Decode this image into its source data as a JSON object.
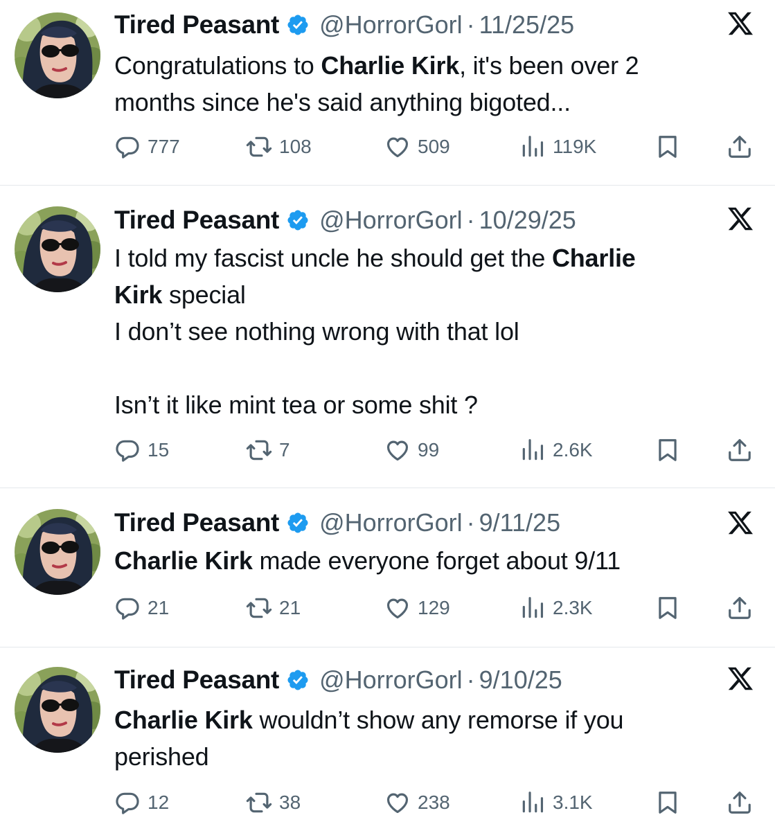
{
  "tweets": [
    {
      "name": "Tired Peasant",
      "handle": "@HorrorGorl",
      "separator": "·",
      "date": "11/25/25",
      "lines": [
        [
          {
            "t": "Congratulations to "
          },
          {
            "t": "Charlie Kirk",
            "b": true
          },
          {
            "t": ", it's been over 2"
          }
        ],
        [
          {
            "t": "months since he's said anything bigoted..."
          }
        ]
      ],
      "stats": {
        "replies": "777",
        "reposts": "108",
        "likes": "509",
        "views": "119K"
      }
    },
    {
      "name": "Tired Peasant",
      "handle": "@HorrorGorl",
      "separator": "·",
      "date": "10/29/25",
      "lines": [
        [
          {
            "t": "I told my fascist uncle he should get the "
          },
          {
            "t": "Charlie",
            "b": true
          }
        ],
        [
          {
            "t": "Kirk",
            "b": true
          },
          {
            "t": " special"
          }
        ],
        [
          {
            "t": "I don’t see nothing wrong with that  lol"
          }
        ],
        [],
        [
          {
            "t": "Isn’t it like mint tea or some shit ?"
          }
        ]
      ],
      "stats": {
        "replies": "15",
        "reposts": "7",
        "likes": "99",
        "views": "2.6K"
      }
    },
    {
      "name": "Tired Peasant",
      "handle": "@HorrorGorl",
      "separator": "·",
      "date": "9/11/25",
      "lines": [
        [
          {
            "t": "Charlie Kirk",
            "b": true
          },
          {
            "t": " made everyone forget about 9/11"
          }
        ]
      ],
      "stats": {
        "replies": "21",
        "reposts": "21",
        "likes": "129",
        "views": "2.3K"
      }
    },
    {
      "name": "Tired Peasant",
      "handle": "@HorrorGorl",
      "separator": "·",
      "date": "9/10/25",
      "lines": [
        [
          {
            "t": "Charlie Kirk",
            "b": true
          },
          {
            "t": " wouldn’t show any remorse if you"
          }
        ],
        [
          {
            "t": "perished"
          }
        ]
      ],
      "stats": {
        "replies": "12",
        "reposts": "38",
        "likes": "238",
        "views": "3.1K"
      }
    }
  ],
  "colors": {
    "text": "#0f1419",
    "muted": "#536471",
    "verified": "#1d9bf0",
    "divider": "#e4e8eb"
  },
  "icons": [
    "avatar",
    "verified-badge-icon",
    "x-logo-icon",
    "reply-icon",
    "repost-icon",
    "like-icon",
    "views-icon",
    "bookmark-icon",
    "share-icon"
  ]
}
